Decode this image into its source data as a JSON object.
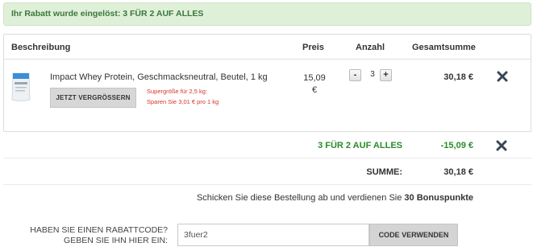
{
  "banner": {
    "text": "Ihr Rabatt wurde eingelöst: 3 FÜR 2 AUF ALLES"
  },
  "table": {
    "headers": {
      "description": "Beschreibung",
      "price": "Preis",
      "quantity": "Anzahl",
      "total": "Gesamtsumme"
    },
    "item": {
      "name": "Impact Whey Protein, Geschmacksneutral, Beutel, 1 kg",
      "zoom_button": "JETZT VERGRÖSSERN",
      "promo_line1": "Supergröße für 2,5 kg:",
      "promo_line2": "Sparen Sie 3,01 € pro 1 kg",
      "price_value": "15,09",
      "price_currency": "€",
      "decrement": "-",
      "quantity": "3",
      "increment": "+",
      "total": "30,18 €"
    }
  },
  "discount": {
    "label": "3 FÜR 2 AUF ALLES",
    "value": "-15,09 €"
  },
  "sum": {
    "label": "SUMME:",
    "value": "30,18 €"
  },
  "bonus": {
    "prefix": "Schicken Sie diese Bestellung ab und verdienen Sie ",
    "points": "30 Bonuspunkte"
  },
  "coupon": {
    "label_line1": "HABEN SIE EINEN RABATTCODE?",
    "label_line2": "GEBEN SIE IHN HIER EIN:",
    "input_value": "3fuer2",
    "button": "CODE VERWENDEN"
  },
  "colors": {
    "banner_bg": "#dff0d8",
    "banner_text": "#3c763d",
    "discount_green": "#2a8a2a",
    "promo_red": "#d9322a",
    "remove_icon": "#3a4654"
  },
  "icons": {
    "remove": "close-icon",
    "product": "product-bag-icon"
  }
}
